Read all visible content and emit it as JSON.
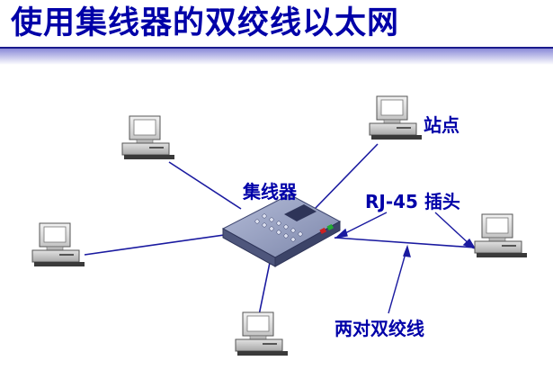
{
  "title": "使用集线器的双绞线以太网",
  "labels": {
    "station": "站点",
    "hub": "集线器",
    "rj45": "RJ-45 插头",
    "twisted_pair": "两对双绞线"
  },
  "colors": {
    "title": "#0000a8",
    "label": "#0000a8",
    "line": "#1a1aa0",
    "hub_body": "#8c96b8"
  }
}
